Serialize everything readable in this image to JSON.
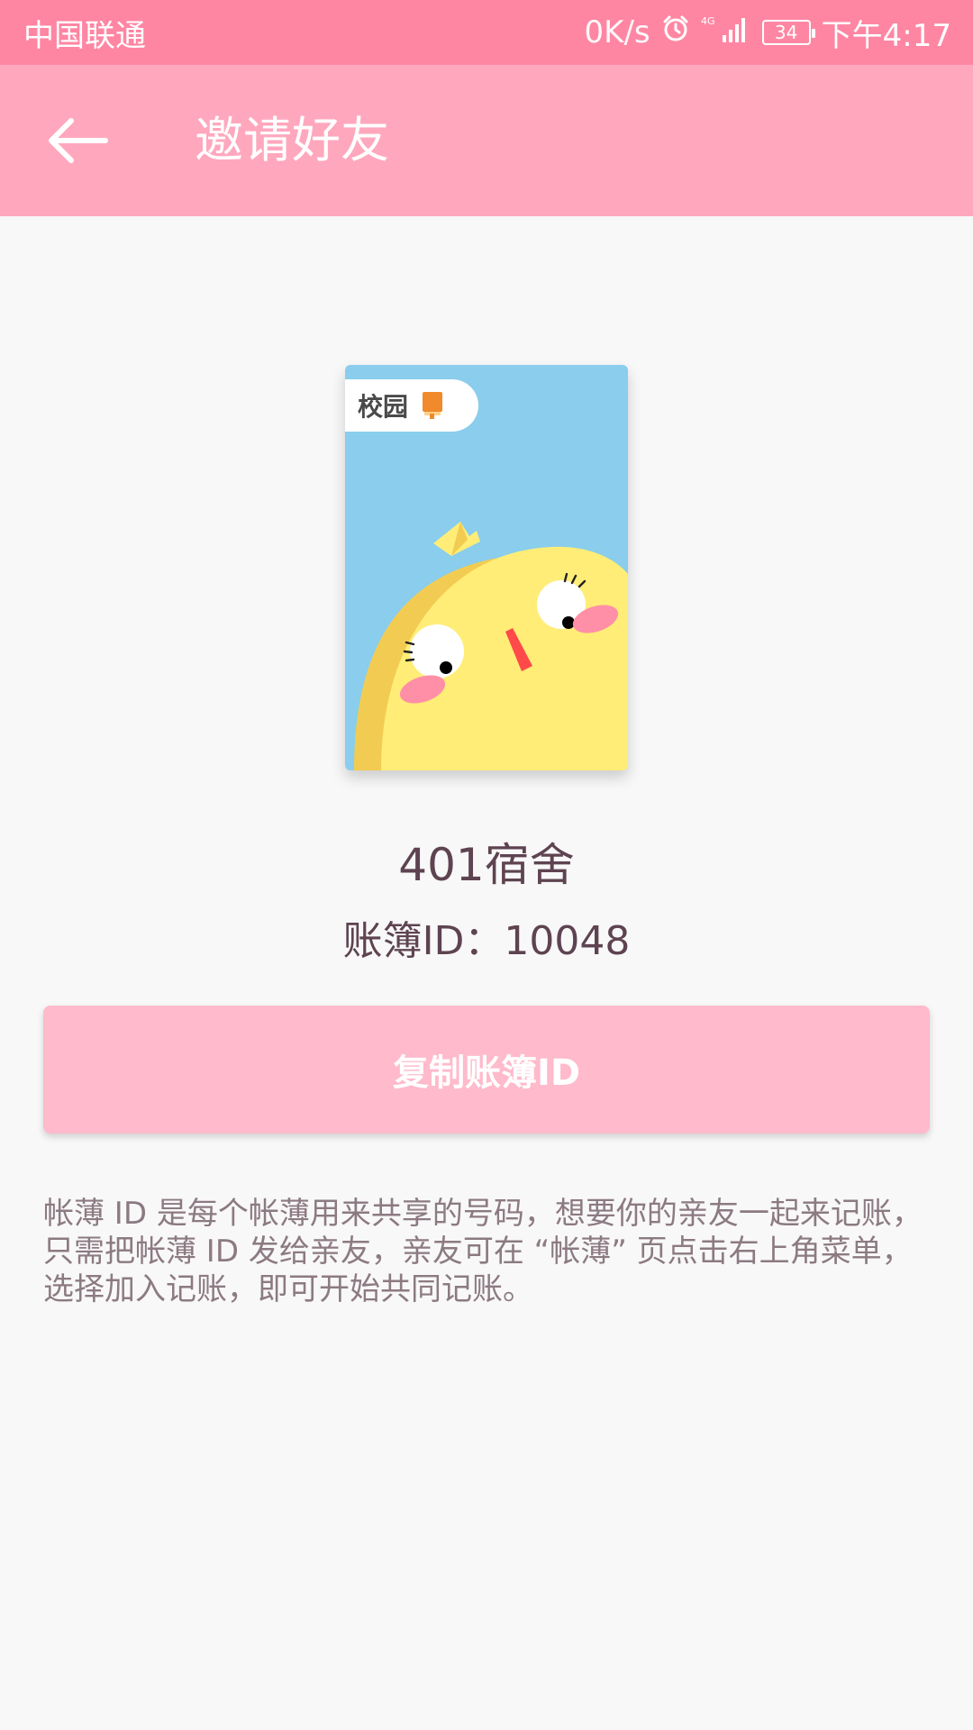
{
  "status_bar": {
    "carrier": "中国联通",
    "net_speed": "0K/s",
    "network": "4G",
    "battery": "34",
    "time": "下午4:17"
  },
  "app_bar": {
    "title": "邀请好友",
    "back_icon": "arrow-left-icon"
  },
  "cover": {
    "tag_text": "校园",
    "colors": {
      "background": "#8acdec",
      "chick_body": "#ffed77",
      "chick_shadow": "#f2cc52",
      "beak": "#ff4a4a",
      "cheek": "#ff8fa6",
      "book_icon": "#f08a2a"
    }
  },
  "book": {
    "name": "401宿舍",
    "id_line": "账簿ID：10048"
  },
  "copy_button": {
    "label": "复制账簿ID"
  },
  "description": "帐薄 ID 是每个帐薄用来共享的号码，想要你的亲友一起来记账，只需把帐薄 ID 发给亲友，亲友可在 “帐薄” 页点击右上角菜单，选择加入记账，即可开始共同记账。",
  "theme": {
    "status_bar": "#ff86a3",
    "app_bar": "#ffa8bd",
    "button": "#ffbacb",
    "text_dark": "#5e4350",
    "text_muted": "#8c7a82",
    "page_bg": "#f8f8f8"
  }
}
